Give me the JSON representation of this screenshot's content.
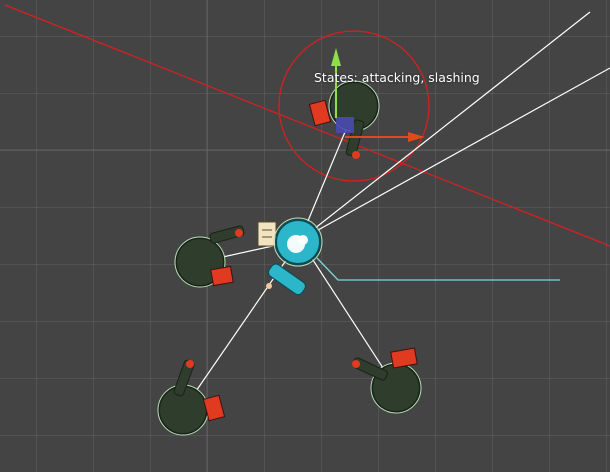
{
  "scene": {
    "selected_enemy": {
      "states_text": "States: attacking, slashing"
    }
  },
  "colors": {
    "background": "#444444",
    "grid_line": "#5a5a5a",
    "sight_line": "#d42020",
    "detection_radius": "#d42020",
    "connection_line": "#ffffff",
    "player_body": "#2bb6c9",
    "player_path": "#7ad8dc",
    "enemy_body": "#2e3d2c",
    "enemy_accent": "#e03a20",
    "gizmo_arrow_up": "#8ee04a",
    "gizmo_arrow_right": "#e04a1a",
    "gizmo_box": "#4a4ab0"
  }
}
